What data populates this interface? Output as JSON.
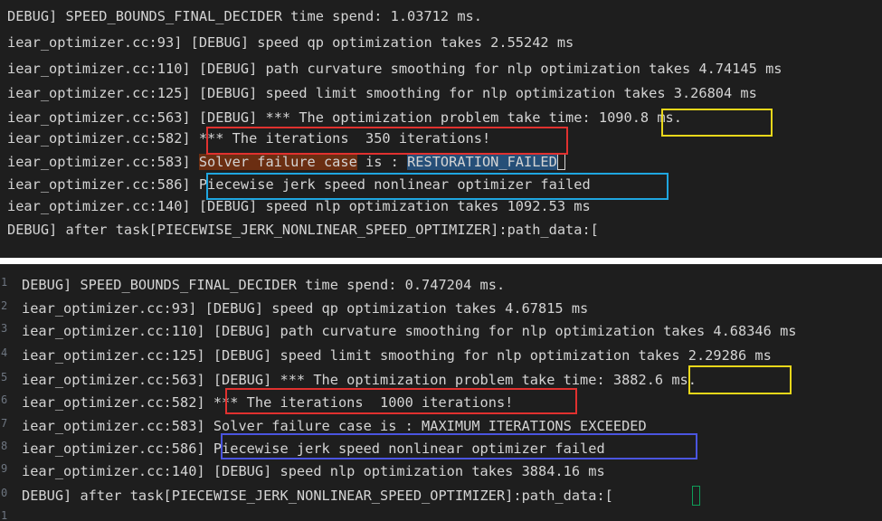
{
  "panel_top": {
    "lines": [
      "DEBUG] SPEED_BOUNDS_FINAL_DECIDER time spend: 1.03712 ms.",
      "iear_optimizer.cc:93] [DEBUG] speed qp optimization takes 2.55242 ms",
      "iear_optimizer.cc:110] [DEBUG] path curvature smoothing for nlp optimization takes 4.74145 ms",
      "iear_optimizer.cc:125] [DEBUG] speed limit smoothing for nlp optimization takes 3.26804 ms",
      "iear_optimizer.cc:563] [DEBUG] *** The optimization problem take time: 1090.8 ms.",
      "iear_optimizer.cc:582] *** The iterations  350 iterations!",
      "iear_optimizer.cc:583] ",
      "iear_optimizer.cc:586] Piecewise jerk speed nonlinear optimizer failed",
      "iear_optimizer.cc:140] [DEBUG] speed nlp optimization takes 1092.53 ms",
      "DEBUG] after task[PIECEWISE_JERK_NONLINEAR_SPEED_OPTIMIZER]:path_data:["
    ],
    "failure_parts": {
      "highlighted": "Solver failure case",
      "middle": " is : ",
      "selected": "RESTORATION_FAILED"
    }
  },
  "panel_bottom": {
    "line_numbers": [
      "1",
      "2",
      "3",
      "4",
      "5",
      "6",
      "7",
      "8",
      "9",
      "0",
      "1"
    ],
    "lines": [
      "DEBUG] SPEED_BOUNDS_FINAL_DECIDER time spend: 0.747204 ms.",
      "iear_optimizer.cc:93] [DEBUG] speed qp optimization takes 4.67815 ms",
      "iear_optimizer.cc:110] [DEBUG] path curvature smoothing for nlp optimization takes 4.68346 ms",
      "iear_optimizer.cc:125] [DEBUG] speed limit smoothing for nlp optimization takes 2.29286 ms",
      "iear_optimizer.cc:563] [DEBUG] *** The optimization problem take time: 3882.6 ms.",
      "iear_optimizer.cc:582] *** The iterations  1000 iterations!",
      "iear_optimizer.cc:583] Solver failure case is : MAXIMUM_ITERATIONS_EXCEEDED",
      "iear_optimizer.cc:586] Piecewise jerk speed nonlinear optimizer failed",
      "iear_optimizer.cc:140] [DEBUG] speed nlp optimization takes 3884.16 ms",
      "DEBUG] after task[PIECEWISE_JERK_NONLINEAR_SPEED_OPTIMIZER]:path_data:["
    ]
  },
  "colors": {
    "editor_bg": "#1e1e1e",
    "text": "#d4d4d4",
    "red_box": "#e0312f",
    "yellow_box": "#e8d71a",
    "cyan_box": "#1fa6e0",
    "blue_box": "#4a55e0"
  }
}
